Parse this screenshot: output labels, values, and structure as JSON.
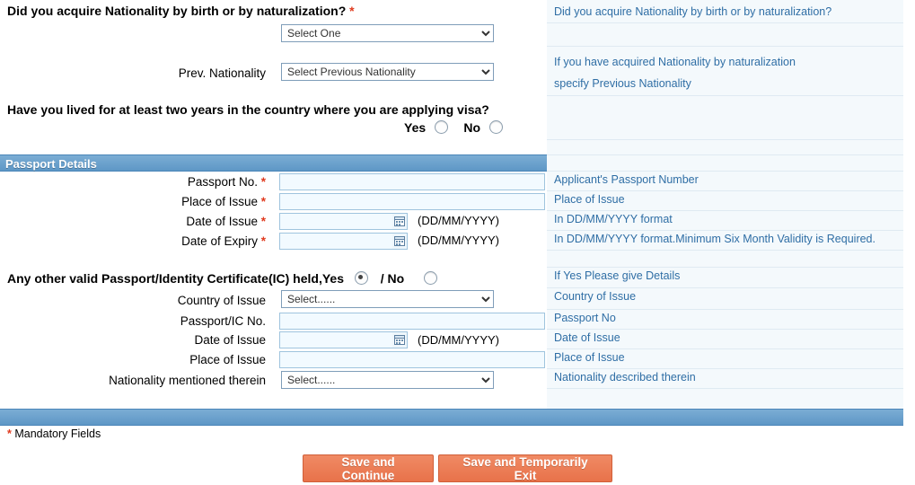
{
  "questions": {
    "nationality_acquire": "Did you acquire Nationality by birth or by naturalization?",
    "lived_two_years": "Have you lived for at least two years in the country where you are applying visa?",
    "other_passport": "Any other valid Passport/Identity Certificate(IC) held,Yes",
    "other_passport_no": "/ No"
  },
  "labels": {
    "prev_nationality": "Prev. Nationality",
    "passport_no": "Passport No.",
    "place_of_issue": "Place of Issue",
    "date_of_issue": "Date of Issue",
    "date_of_expiry": "Date of Expiry",
    "country_of_issue": "Country of Issue",
    "passport_ic_no": "Passport/IC No.",
    "date_of_issue2": "Date of Issue",
    "place_of_issue2": "Place of Issue",
    "nationality_mentioned": "Nationality mentioned therein",
    "yes": "Yes",
    "no": "No",
    "date_format": "(DD/MM/YYYY)",
    "required_star": "*"
  },
  "selects": {
    "acquire_nationality": "Select One",
    "prev_nationality": "Select Previous Nationality",
    "country_of_issue": "Select......",
    "nationality_mentioned": "Select......"
  },
  "inputs": {
    "passport_no": "",
    "place_of_issue": "",
    "date_of_issue": "",
    "date_of_expiry": "",
    "passport_ic_no": "",
    "date_of_issue2": "",
    "place_of_issue2": ""
  },
  "section": {
    "passport_details": "Passport Details"
  },
  "help": {
    "h1": "Did you acquire Nationality by birth or by naturalization?",
    "h2": "If you have acquired Nationality by naturalization",
    "h3": "specify Previous Nationality",
    "h4": "Applicant's Passport Number",
    "h5": "Place of Issue",
    "h6": "In DD/MM/YYYY format",
    "h7": "In DD/MM/YYYY format.Minimum Six Month Validity is Required.",
    "h8": "If Yes Please give Details",
    "h9": "Country of Issue",
    "h10": "Passport No",
    "h11": "Date of Issue",
    "h12": "Place of Issue",
    "h13": "Nationality described therein"
  },
  "footer": {
    "mandatory_star": "*",
    "mandatory_text": "Mandatory Fields",
    "save_continue": "Save and Continue",
    "save_exit": "Save and Temporarily Exit"
  },
  "colors": {
    "section_bar": "#5e97c6",
    "help_text": "#2f6ea5",
    "button": "#e8724a",
    "required": "#e03a1e"
  }
}
